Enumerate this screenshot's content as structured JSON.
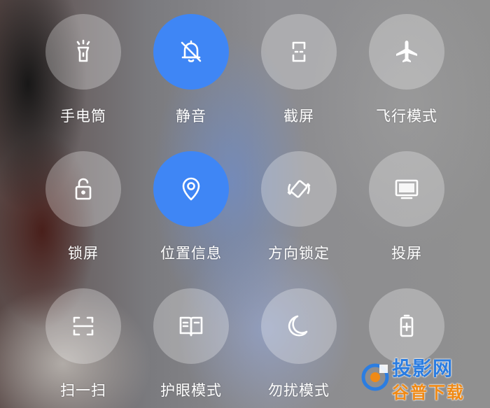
{
  "tiles": [
    {
      "label": "手电筒",
      "icon": "flashlight-icon",
      "active": false
    },
    {
      "label": "静音",
      "icon": "bell-off-icon",
      "active": true
    },
    {
      "label": "截屏",
      "icon": "screenshot-icon",
      "active": false
    },
    {
      "label": "飞行模式",
      "icon": "airplane-icon",
      "active": false
    },
    {
      "label": "锁屏",
      "icon": "lock-icon",
      "active": false
    },
    {
      "label": "位置信息",
      "icon": "location-pin-icon",
      "active": true
    },
    {
      "label": "方向锁定",
      "icon": "rotation-lock-icon",
      "active": false
    },
    {
      "label": "投屏",
      "icon": "monitor-icon",
      "active": false
    },
    {
      "label": "扫一扫",
      "icon": "scan-icon",
      "active": false
    },
    {
      "label": "护眼模式",
      "icon": "book-icon",
      "active": false
    },
    {
      "label": "勿扰模式",
      "icon": "moon-icon",
      "active": false
    },
    {
      "label": "",
      "icon": "battery-saver-icon",
      "active": false
    }
  ],
  "colors": {
    "active": "#3f86f5",
    "inactive": "rgba(255,255,255,0.28)",
    "label": "#ffffff"
  },
  "watermark": {
    "top": "投影网",
    "bottom": "谷普下载"
  }
}
